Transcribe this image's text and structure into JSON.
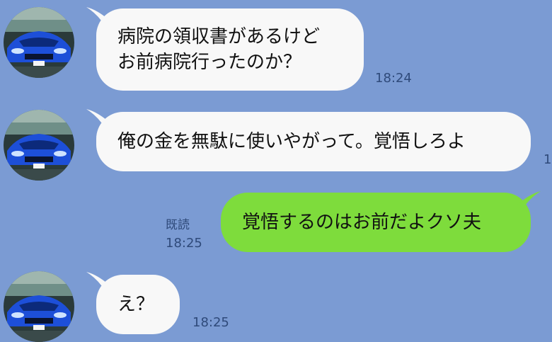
{
  "messages": [
    {
      "direction": "incoming",
      "avatar": "sports-car-avatar",
      "lines": [
        "病院の領収書があるけど",
        "お前病院行ったのか？"
      ],
      "time": "18:24"
    },
    {
      "direction": "incoming",
      "avatar": "sports-car-avatar",
      "text": "俺の金を無駄に使いやがって。覚悟しろよ",
      "time": "1"
    },
    {
      "direction": "outgoing",
      "text": "覚悟するのはお前だよクソ夫",
      "read_label": "既読",
      "time": "18:25"
    },
    {
      "direction": "incoming",
      "avatar": "sports-car-avatar",
      "text": "え？",
      "time": "18:25"
    }
  ],
  "colors": {
    "background": "#7b9bd3",
    "incoming_bubble": "#f8f8f8",
    "outgoing_bubble": "#7edc3c",
    "meta_text": "#2f4a7a"
  }
}
